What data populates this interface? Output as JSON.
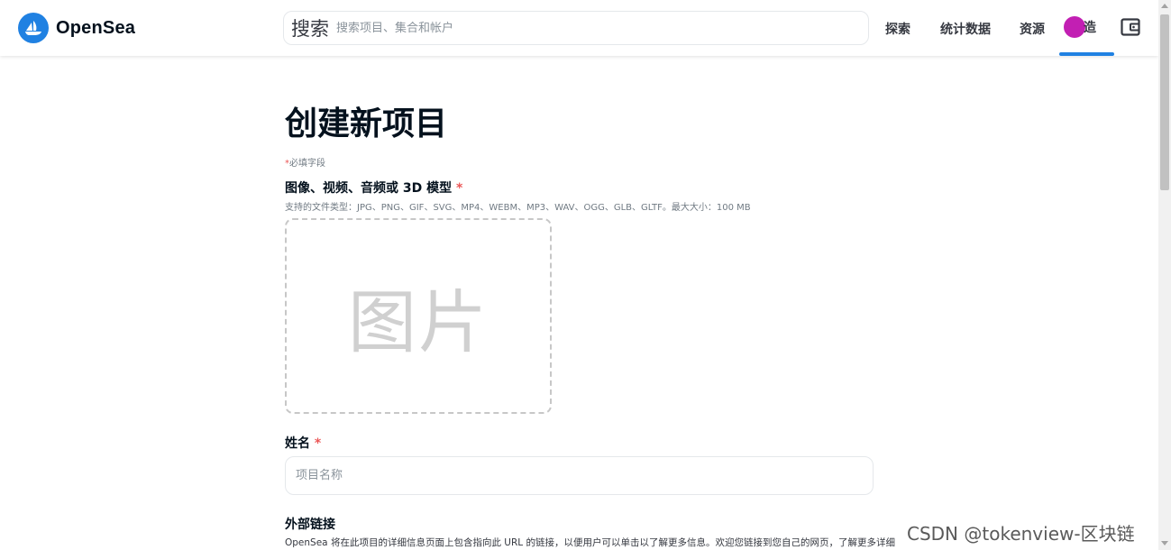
{
  "nav": {
    "brand": "OpenSea",
    "search_icon_text": "搜索",
    "search_placeholder": "搜索项目、集合和帐户",
    "links": [
      "探索",
      "统计数据",
      "资源"
    ],
    "create_label": "造",
    "brand_color": "#2081e2",
    "icons": [
      "opensea-logo-icon",
      "avatar-icon",
      "wallet-icon"
    ]
  },
  "form": {
    "title": "创建新项目",
    "required_star": "*",
    "required_note": "必填字段",
    "media": {
      "label": "图像、视频、音频或 3D 模型",
      "hint": "支持的文件类型：JPG、PNG、GIF、SVG、MP4、WEBM、MP3、WAV、OGG、GLB、GLTF。最大大小：100 MB",
      "dropzone_text": "图片"
    },
    "name": {
      "label": "姓名",
      "placeholder": "项目名称"
    },
    "external_link": {
      "label": "外部链接",
      "description": "OpenSea 将在此项目的详细信息页面上包含指向此 URL 的链接，以便用户可以单击以了解更多信息。欢迎您链接到您自己的网页，了解更多详细"
    }
  },
  "watermark": "CSDN @tokenview-区块链"
}
